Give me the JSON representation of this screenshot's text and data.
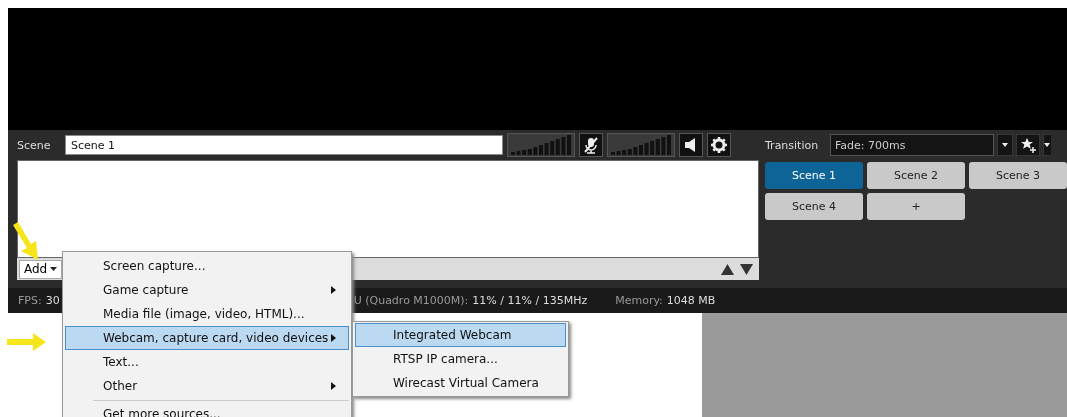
{
  "scene": {
    "label": "Scene",
    "value": "Scene 1"
  },
  "sources": {
    "add_button": "Add"
  },
  "transition": {
    "label": "Transition",
    "value": "Fade: 700ms"
  },
  "scenes": [
    {
      "label": "Scene 1",
      "selected": true
    },
    {
      "label": "Scene 2",
      "selected": false
    },
    {
      "label": "Scene 3",
      "selected": false
    },
    {
      "label": "Scene 4",
      "selected": false
    },
    {
      "label": "+",
      "selected": false
    }
  ],
  "status_bar": {
    "fps_label": "FPS:",
    "fps_value": "30",
    "gpu_label": "U (Quadro M1000M):",
    "gpu_value": "11% / 11% / 135MHz",
    "memory_label": "Memory:",
    "memory_value": "1048 MB"
  },
  "menu": [
    {
      "label": "Screen capture...",
      "submenu": false,
      "selected": false
    },
    {
      "label": "Game capture",
      "submenu": true,
      "selected": false
    },
    {
      "label": "Media file (image, video, HTML)...",
      "submenu": false,
      "selected": false
    },
    {
      "label": "Webcam, capture card, video devices",
      "submenu": true,
      "selected": true
    },
    {
      "label": "Text...",
      "submenu": false,
      "selected": false
    },
    {
      "label": "Other",
      "submenu": true,
      "selected": false
    },
    {
      "label": "Get more sources...",
      "submenu": false,
      "selected": false
    }
  ],
  "submenu": [
    {
      "label": "Integrated Webcam",
      "selected": true
    },
    {
      "label": "RTSP IP camera...",
      "selected": false
    },
    {
      "label": "Wirecast Virtual Camera",
      "selected": false
    }
  ]
}
